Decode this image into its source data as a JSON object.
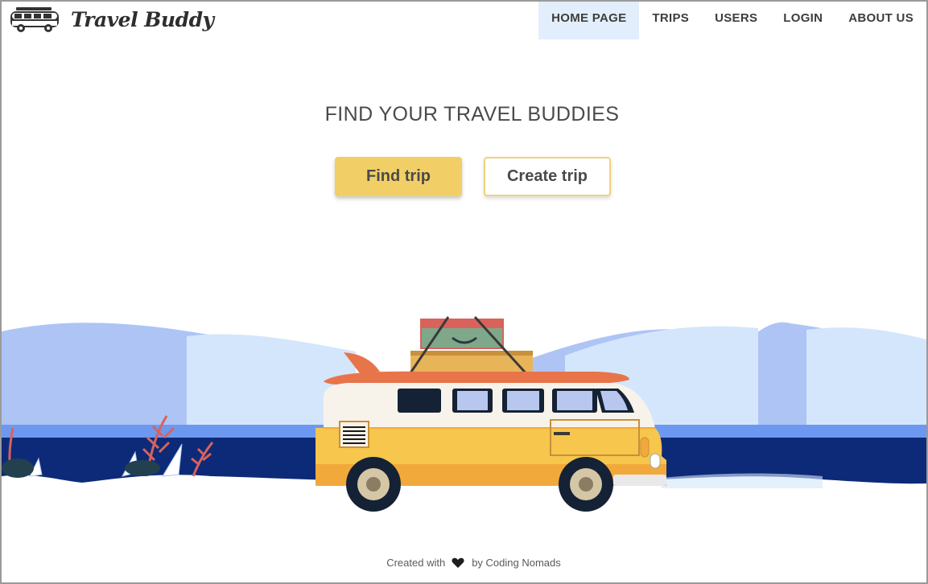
{
  "brand": {
    "name": "Travel Buddy"
  },
  "nav": {
    "items": [
      {
        "label": "HOME PAGE",
        "active": true
      },
      {
        "label": "TRIPS"
      },
      {
        "label": "USERS"
      },
      {
        "label": "LOGIN"
      },
      {
        "label": "ABOUT US"
      }
    ]
  },
  "hero": {
    "headline": "FIND YOUR TRAVEL BUDDIES",
    "find_label": "Find trip",
    "create_label": "Create trip",
    "illustration_icon": "camper-van-icon"
  },
  "footer": {
    "prefix": "Created with",
    "icon": "heart-icon",
    "suffix": "by Coding Nomads"
  },
  "colors": {
    "accent": "#f2cf66",
    "active_nav": "#e2eefb",
    "sea": "#0d2a78",
    "mountain": "#aec4f5"
  }
}
